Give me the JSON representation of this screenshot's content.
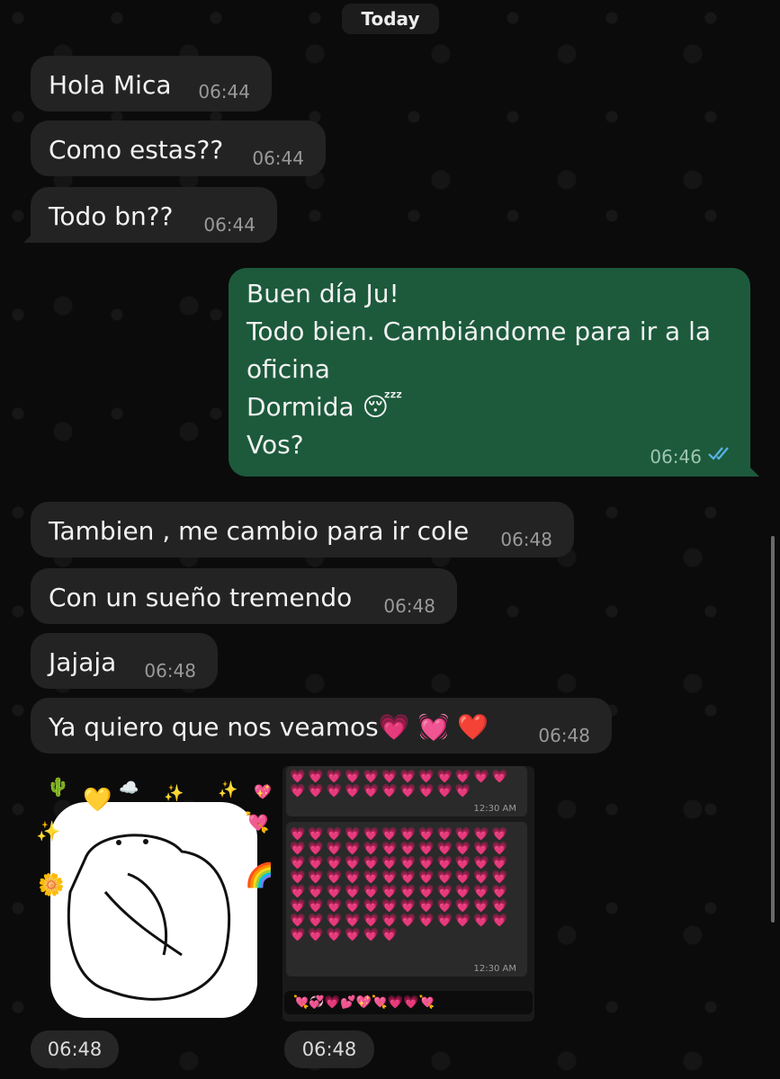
{
  "date_label": "Today",
  "messages": [
    {
      "text": "Hola Mica",
      "time": "06:44"
    },
    {
      "text": "Como estas??",
      "time": "06:44"
    },
    {
      "text": "Todo bn??",
      "time": "06:44"
    },
    {
      "text": "Buen día Ju!\nTodo bien. Cambiándome para ir a la\noficina\nDormida 😴\nVos?",
      "time": "06:46",
      "status": "read"
    },
    {
      "text": "Tambien , me cambio para ir cole",
      "time": "06:48"
    },
    {
      "text": "Con un sueño tremendo",
      "time": "06:48"
    },
    {
      "text": "Jajaja",
      "time": "06:48"
    },
    {
      "text": "Ya quiero que nos veamos💗 💓 ❤️",
      "time": "06:48"
    }
  ],
  "media": [
    {
      "type": "sticker",
      "time": "06:48"
    },
    {
      "type": "image",
      "time": "06:48",
      "screenshot_times": [
        "12:30 AM",
        "12:30 AM"
      ]
    }
  ],
  "colors": {
    "incoming_bubble": "#232323",
    "outgoing_bubble": "#1c5a3b",
    "read_ticks": "#5ab3e6"
  },
  "icons": {
    "read_receipt": "double-check-icon"
  }
}
